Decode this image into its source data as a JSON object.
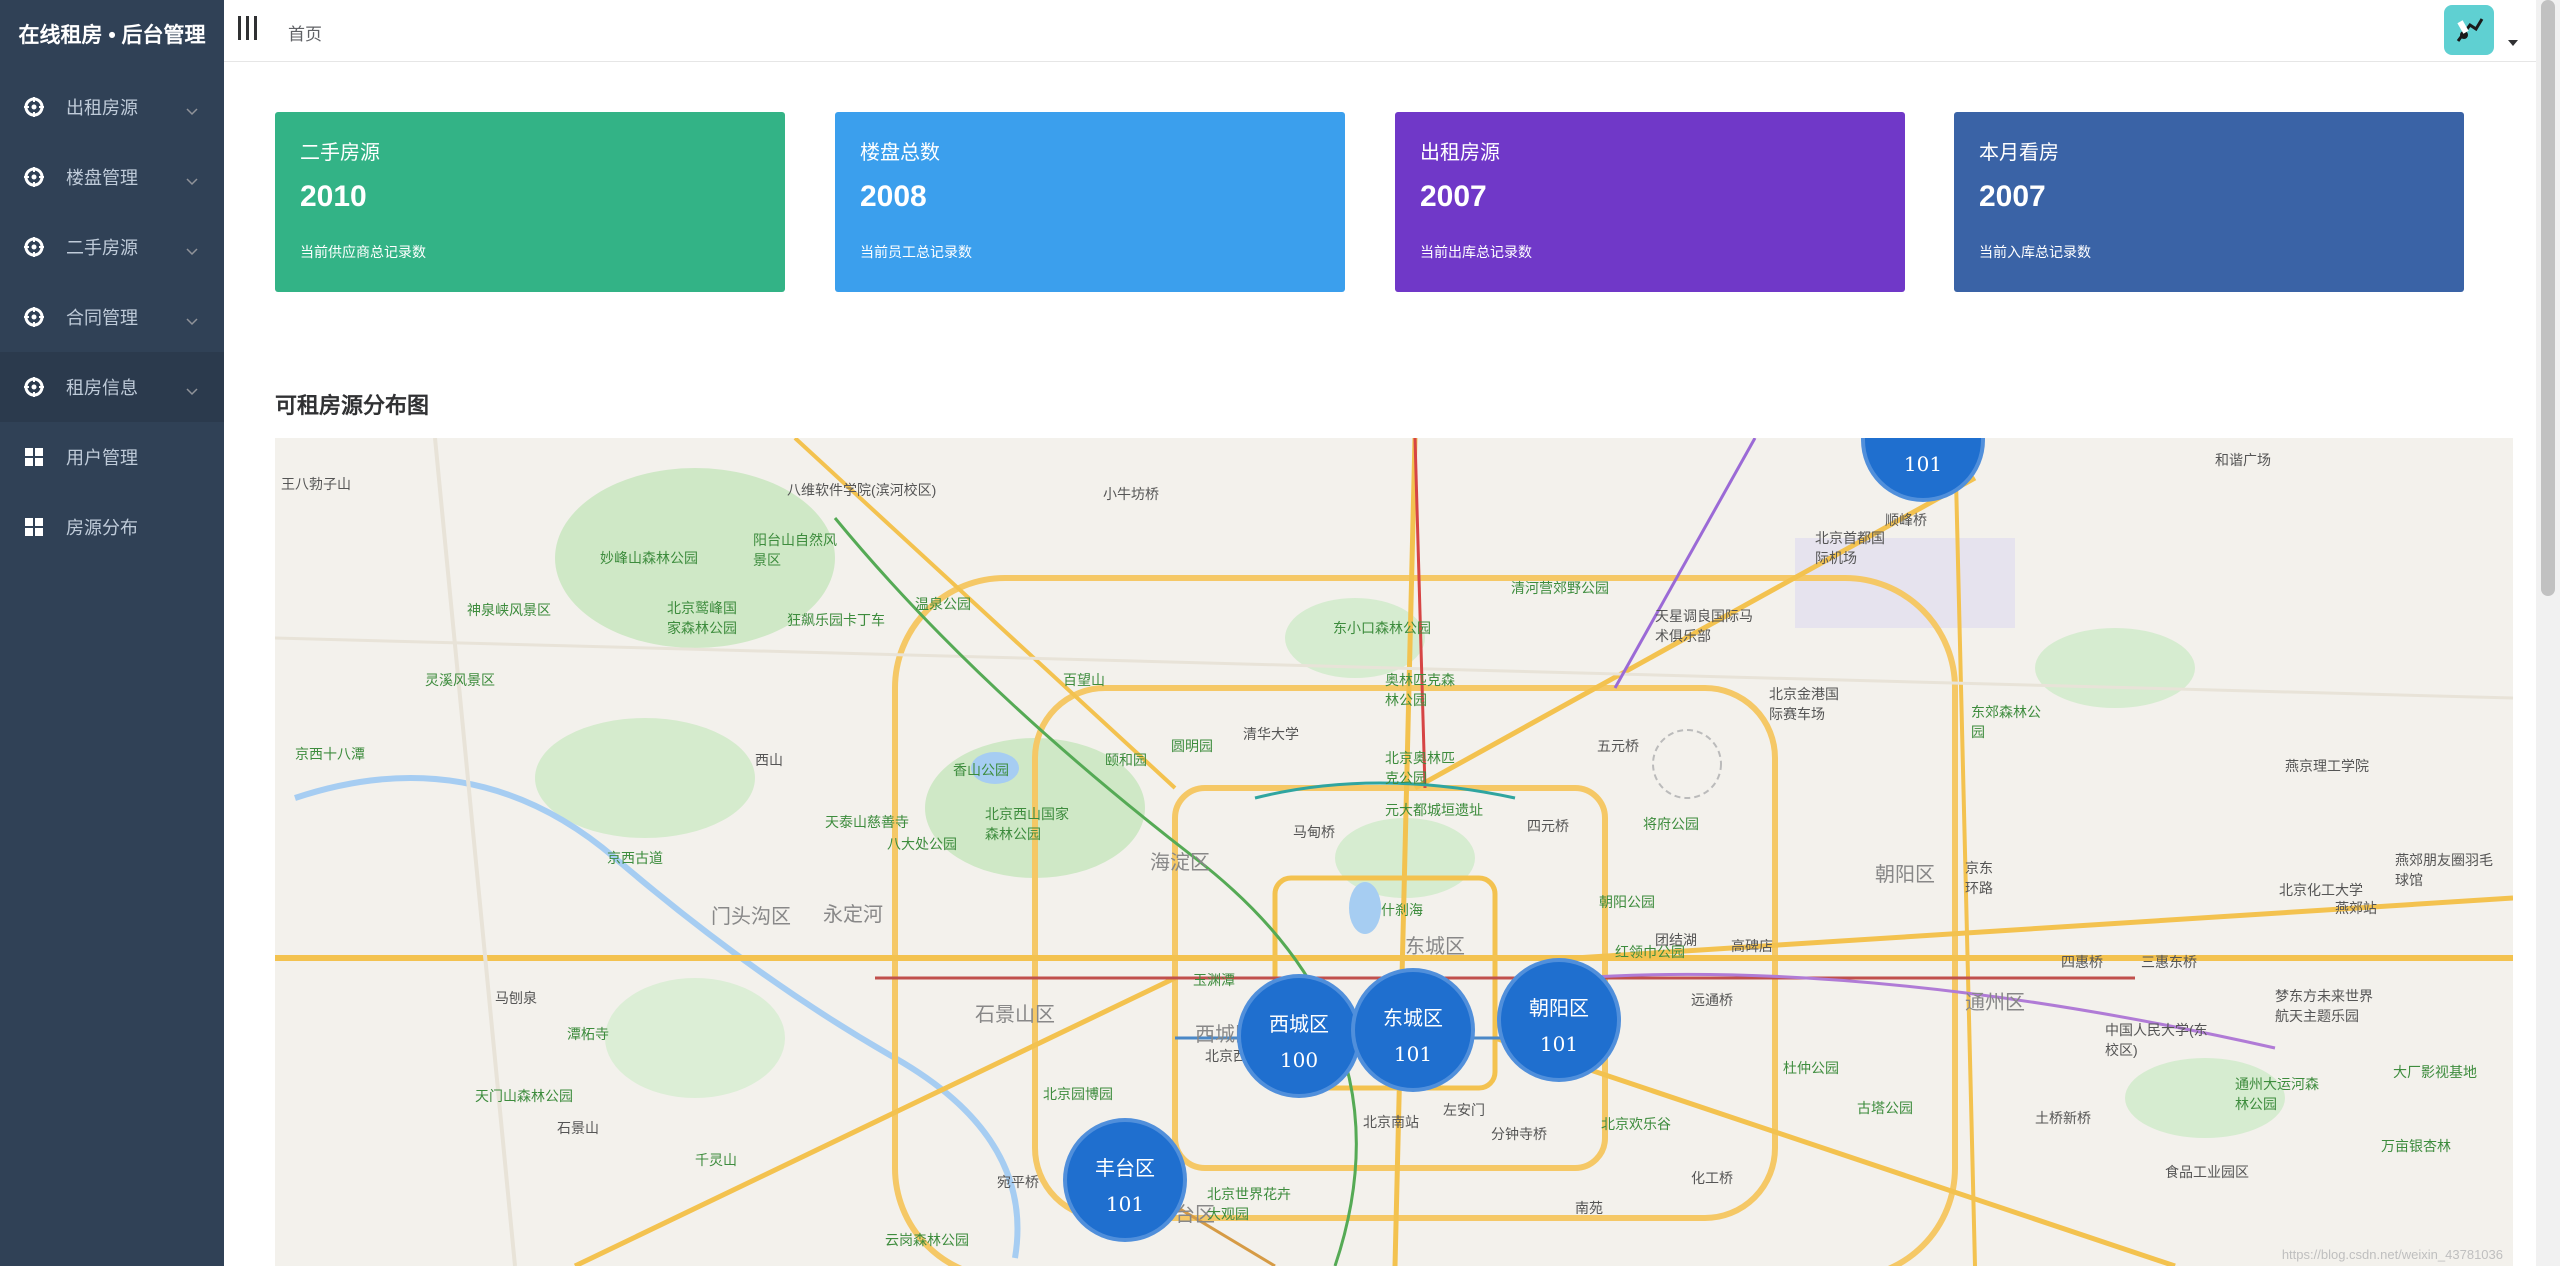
{
  "app": {
    "title": "在线租房 • 后台管理"
  },
  "sidebar": {
    "items": [
      {
        "label": "出租房源",
        "icon": "gear-icon",
        "has_submenu": true
      },
      {
        "label": "楼盘管理",
        "icon": "gear-icon",
        "has_submenu": true
      },
      {
        "label": "二手房源",
        "icon": "gear-icon",
        "has_submenu": true
      },
      {
        "label": "合同管理",
        "icon": "gear-icon",
        "has_submenu": true
      },
      {
        "label": "租房信息",
        "icon": "gear-icon",
        "has_submenu": true
      },
      {
        "label": "用户管理",
        "icon": "grid-icon",
        "has_submenu": false
      },
      {
        "label": "房源分布",
        "icon": "grid-icon",
        "has_submenu": false
      }
    ]
  },
  "header": {
    "breadcrumb": "首页"
  },
  "cards": [
    {
      "title": "二手房源",
      "value": "2010",
      "desc": "当前供应商总记录数",
      "color": "#33b386"
    },
    {
      "title": "楼盘总数",
      "value": "2008",
      "desc": "当前员工总记录数",
      "color": "#3b9fed"
    },
    {
      "title": "出租房源",
      "value": "2007",
      "desc": "当前出库总记录数",
      "color": "#7038c8"
    },
    {
      "title": "本月看房",
      "value": "2007",
      "desc": "当前入库总记录数",
      "color": "#3a63a6"
    }
  ],
  "map_section": {
    "title": "可租房源分布图",
    "clusters": [
      {
        "name": "",
        "count": "101"
      },
      {
        "name": "西城区",
        "count": "100"
      },
      {
        "name": "东城区",
        "count": "101"
      },
      {
        "name": "朝阳区",
        "count": "101"
      },
      {
        "name": "丰台区",
        "count": "101"
      }
    ],
    "places": [
      "王八勃子山",
      "八维软件学院(滨河校区)",
      "小牛坊桥",
      "顺峰桥",
      "和谐广场",
      "北京首都国际机场",
      "阳台山自然风景区",
      "妙峰山森林公园",
      "神泉峡风景区",
      "北京鹫峰国家森林公园",
      "狂飙乐园卡丁车",
      "温泉公园",
      "清河营郊野公园",
      "东小口森林公园",
      "天星调良国际马术俱乐部",
      "灵溪风景区",
      "百望山",
      "颐和园",
      "圆明园",
      "清华大学",
      "奥林匹克森林公园",
      "北京奥林匹克公园",
      "元大都城垣遗址",
      "京西十八潭",
      "香山公园",
      "北京西山国家森林公园",
      "天泰山慈善寺",
      "八大处公园",
      "北京金港国际赛车场",
      "海淀区",
      "马甸桥",
      "四元桥",
      "五元桥",
      "将府公园",
      "京西古道",
      "永定河",
      "石景山区",
      "门头沟区",
      "东城区",
      "西城区",
      "朝阳区",
      "北京南站",
      "北京西站",
      "丰台区",
      "南苑",
      "通州区",
      "中国人民大学(东校区)",
      "东郊森林公园",
      "燕京理工学院",
      "北京化工大学",
      "燕郊站",
      "北京园博园",
      "宛平桥",
      "北京世界花卉大观园",
      "云岗森林公园",
      "千灵山",
      "天门山森林公园",
      "石景山",
      "潭柘寺",
      "马刨泉",
      "玉渊潭",
      "什刹海",
      "团结湖",
      "朝阳公园",
      "红领巾公园",
      "四惠桥",
      "远通桥",
      "三惠东桥",
      "高碑店",
      "杜仲公园",
      "古塔公园",
      "北京欢乐谷",
      "分钟寺桥",
      "左安门",
      "化工桥",
      "土桥新桥",
      "梦东方未来世界航天主题乐园",
      "大厂影视基地",
      "万亩银杏林",
      "食品工业园区",
      "通州大运河森林公园",
      "燕郊朋友圈羽毛球馆",
      "西山",
      "京东环路"
    ],
    "watermark": "https://blog.csdn.net/weixin_43781036"
  }
}
